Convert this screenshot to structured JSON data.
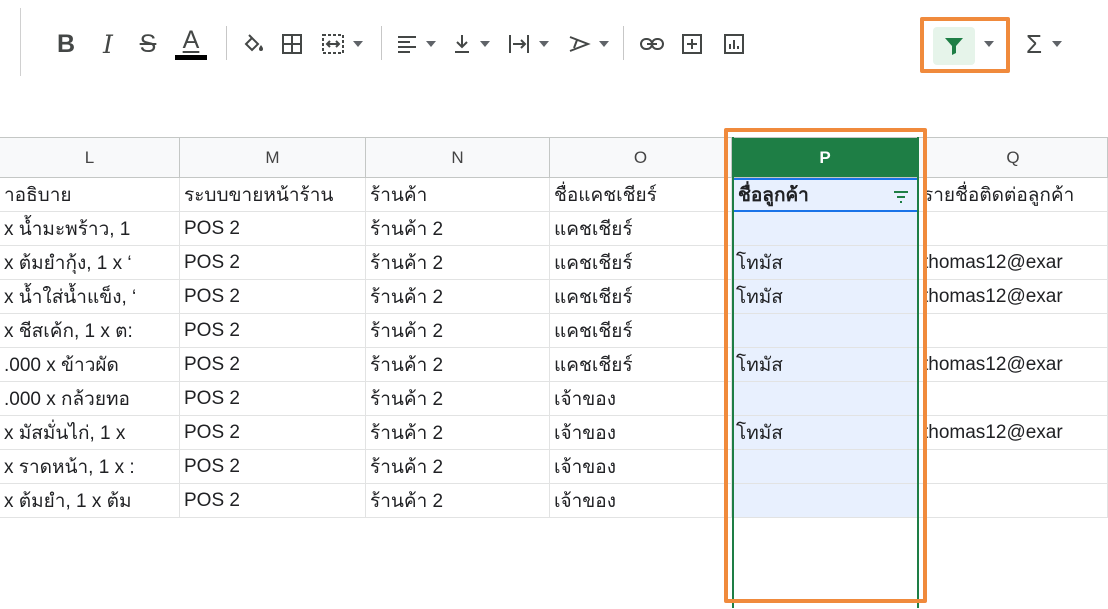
{
  "toolbar": {
    "bold_label": "B",
    "italic_label": "I",
    "strike_label": "S",
    "textcolor_label": "A",
    "textcolor_underline": "#000000",
    "sum_label": "Σ",
    "filter_color": "#1e7e45",
    "highlight_color": "#f08a3c",
    "icons": [
      "bold-icon",
      "italic-icon",
      "strikethrough-icon",
      "text-color-icon",
      "fill-color-icon",
      "borders-icon",
      "merge-cells-icon",
      "align-horizontal-icon",
      "align-vertical-icon",
      "text-wrap-icon",
      "text-rotate-icon",
      "link-icon",
      "comment-icon",
      "chart-icon",
      "filter-icon",
      "functions-icon"
    ]
  },
  "columns": [
    {
      "letter": "L",
      "header": "าอธิบาย"
    },
    {
      "letter": "M",
      "header": "ระบบขายหน้าร้าน"
    },
    {
      "letter": "N",
      "header": "ร้านค้า"
    },
    {
      "letter": "O",
      "header": "ชื่อแคชเชียร์"
    },
    {
      "letter": "P",
      "header": "ชื่อลูกค้า"
    },
    {
      "letter": "Q",
      "header": "รายชื่อติดต่อลูกค้า"
    }
  ],
  "rows": [
    [
      "x น้ำมะพร้าว, 1",
      "POS 2",
      "ร้านค้า 2",
      "แคชเชียร์",
      "",
      ""
    ],
    [
      "x ต้มยำกุ้ง, 1 x ‘",
      "POS 2",
      "ร้านค้า 2",
      "แคชเชียร์",
      "โทมัส",
      "thomas12@exar"
    ],
    [
      "x น้ำใส่น้ำแข็ง, ‘",
      "POS 2",
      "ร้านค้า 2",
      "แคชเชียร์",
      "โทมัส",
      "thomas12@exar"
    ],
    [
      "x ชีสเค้ก, 1 x ต:",
      "POS 2",
      "ร้านค้า 2",
      "แคชเชียร์",
      "",
      ""
    ],
    [
      ".000 x ข้าวผัด",
      "POS 2",
      "ร้านค้า 2",
      "แคชเชียร์",
      "โทมัส",
      "thomas12@exar"
    ],
    [
      ".000 x กล้วยทอ",
      "POS 2",
      "ร้านค้า 2",
      "เจ้าของ",
      "",
      ""
    ],
    [
      "x มัสมั่นไก่, 1 x",
      "POS 2",
      "ร้านค้า 2",
      "เจ้าของ",
      "โทมัส",
      "thomas12@exar"
    ],
    [
      "x ราดหน้า, 1 x :",
      "POS 2",
      "ร้านค้า 2",
      "เจ้าของ",
      "",
      ""
    ],
    [
      "x ต้มยำ, 1 x ต้ม",
      "POS 2",
      "ร้านค้า 2",
      "เจ้าของ",
      "",
      ""
    ]
  ]
}
